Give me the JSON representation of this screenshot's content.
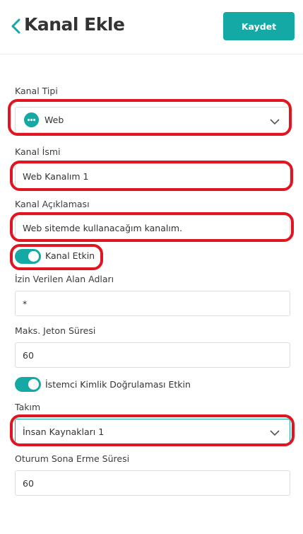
{
  "header": {
    "title": "Kanal Ekle",
    "save_label": "Kaydet"
  },
  "colors": {
    "accent": "#14a9a4",
    "highlight": "#e0151f"
  },
  "form": {
    "channel_type": {
      "label": "Kanal Tipi",
      "value": "Web",
      "icon": "chat-bubble-icon"
    },
    "channel_name": {
      "label": "Kanal İsmi",
      "value": "Web Kanalım 1"
    },
    "channel_description": {
      "label": "Kanal Açıklaması",
      "value": "Web sitemde kullanacağım kanalım."
    },
    "channel_enabled": {
      "label": "Kanal Etkin",
      "on": true
    },
    "allowed_domains": {
      "label": "İzin Verilen Alan Adları",
      "value": "*"
    },
    "max_token_duration": {
      "label": "Maks. Jeton Süresi",
      "value": "60"
    },
    "client_auth_enabled": {
      "label": "İstemci Kimlik Doğrulaması Etkin",
      "on": true
    },
    "team": {
      "label": "Takım",
      "value": "İnsan Kaynakları 1"
    },
    "session_timeout": {
      "label": "Oturum Sona Erme Süresi",
      "value": "60"
    }
  }
}
